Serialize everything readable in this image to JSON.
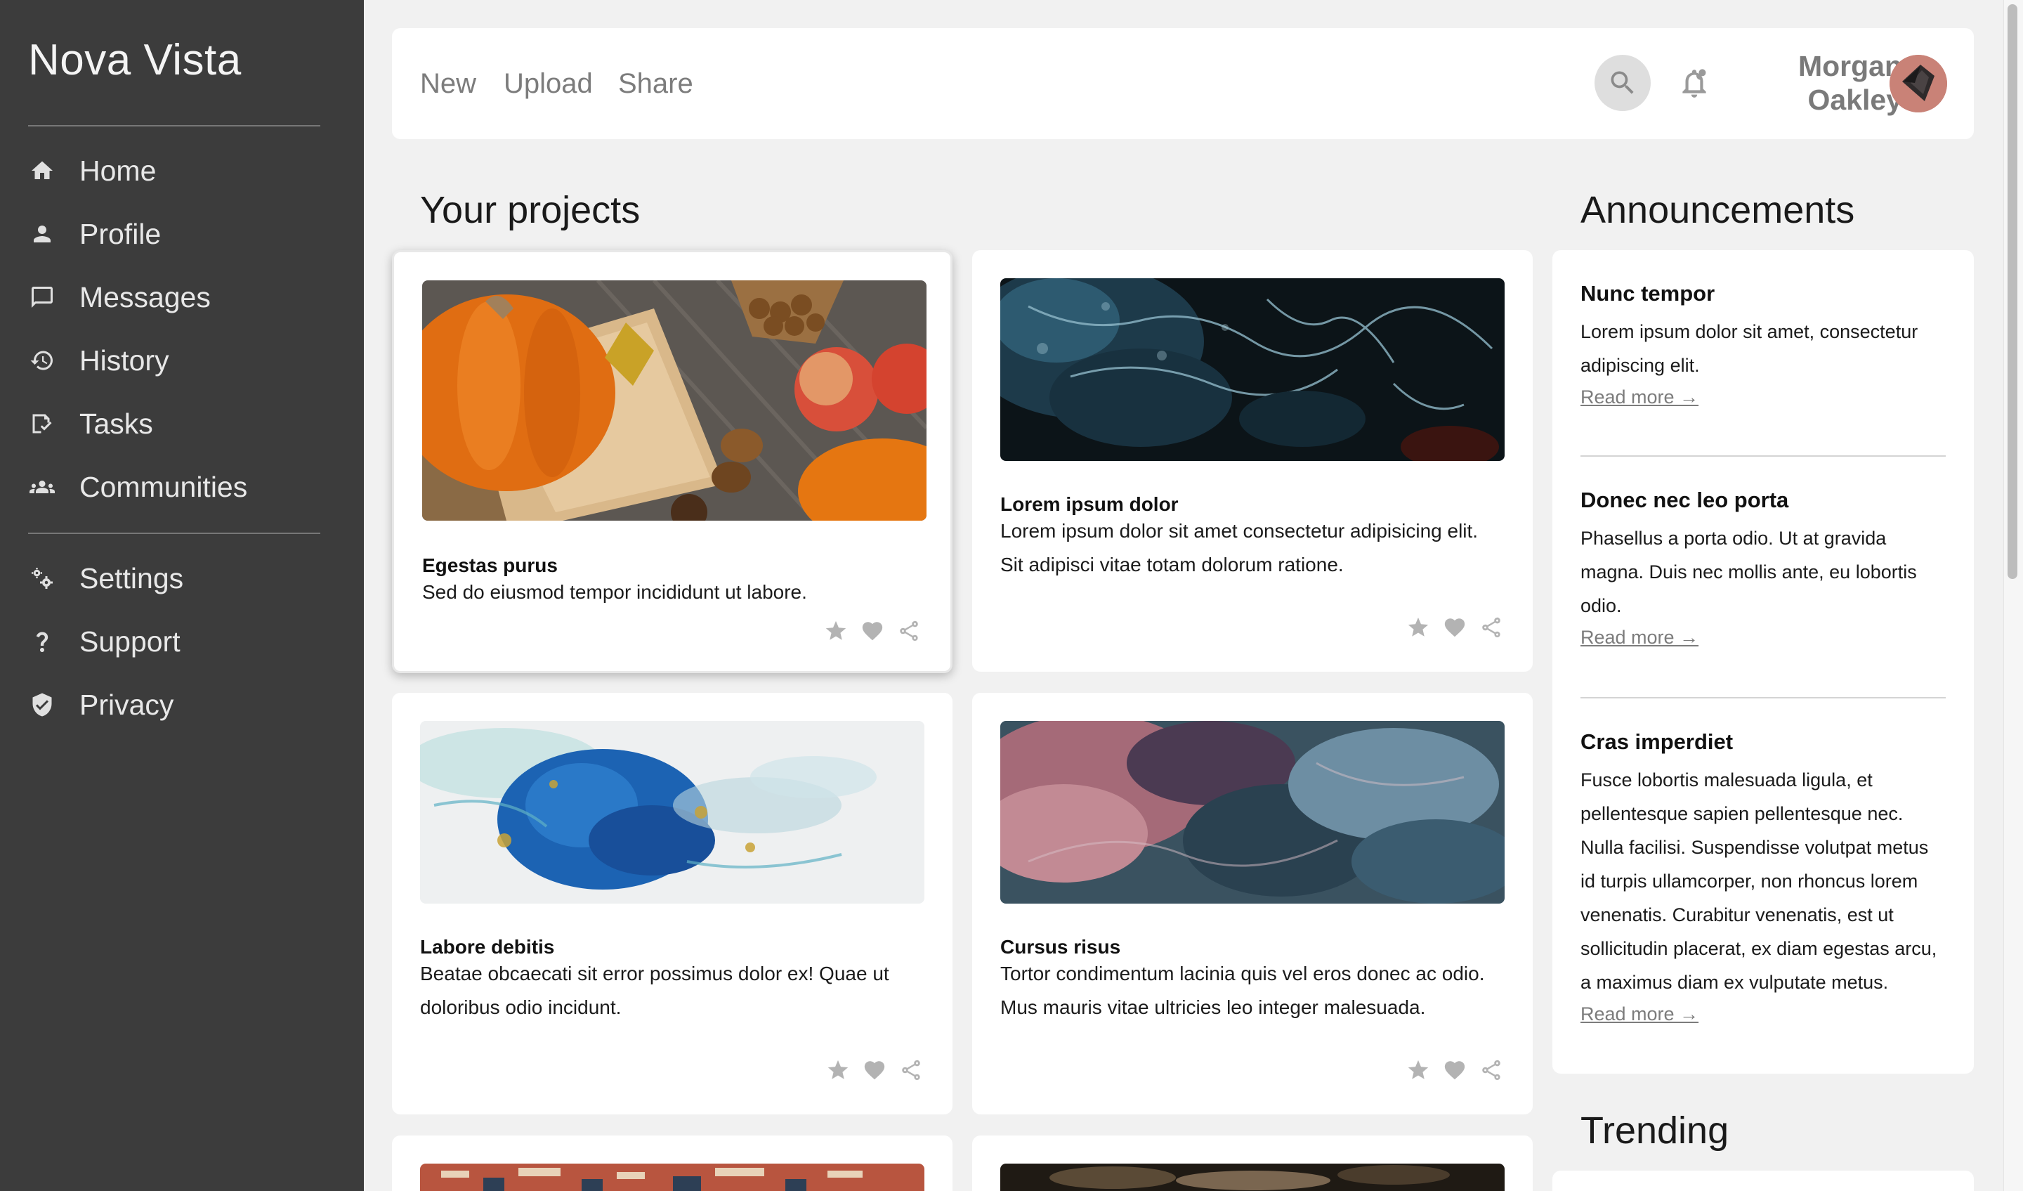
{
  "sidebar": {
    "brand": "Nova Vista",
    "items": [
      {
        "label": "Home",
        "icon": "home-icon"
      },
      {
        "label": "Profile",
        "icon": "person-icon"
      },
      {
        "label": "Messages",
        "icon": "chat-icon"
      },
      {
        "label": "History",
        "icon": "history-icon"
      },
      {
        "label": "Tasks",
        "icon": "tasks-icon"
      },
      {
        "label": "Communities",
        "icon": "group-icon"
      }
    ],
    "secondary_items": [
      {
        "label": "Settings",
        "icon": "gear-icon"
      },
      {
        "label": "Support",
        "icon": "question-icon"
      },
      {
        "label": "Privacy",
        "icon": "shield-icon"
      }
    ]
  },
  "topbar": {
    "tabs": [
      "New",
      "Upload",
      "Share"
    ],
    "search_icon": "search-icon",
    "notification_icon": "bell-icon",
    "user_first": "Morgan",
    "user_last": "Oakley"
  },
  "projects": {
    "heading": "Your projects",
    "cards": [
      {
        "title": "Egestas purus",
        "description": "Sed do eiusmod tempor incididunt ut labore.",
        "image": "autumn-pumpkins-photo"
      },
      {
        "title": "Lorem ipsum dolor",
        "description": "Lorem ipsum dolor sit amet consectetur adipisicing elit. Sit adipisci vitae totam dolorum ratione.",
        "image": "dark-blue-abstract-photo"
      },
      {
        "title": "Labore debitis",
        "description": "Beatae obcaecati sit error possimus dolor ex! Quae ut doloribus odio incidunt.",
        "image": "blue-ink-splash-photo"
      },
      {
        "title": "Cursus risus",
        "description": "Tortor condimentum lacinia quis vel eros donec ac odio. Mus mauris vitae ultricies leo integer malesuada.",
        "image": "pink-teal-smoke-photo"
      }
    ],
    "card_actions": [
      "star-icon",
      "heart-icon",
      "share-icon"
    ]
  },
  "announcements": {
    "heading": "Announcements",
    "items": [
      {
        "title": "Nunc tempor",
        "body": "Lorem ipsum dolor sit amet, consectetur adipiscing elit.",
        "link": "Read more →"
      },
      {
        "title": "Donec nec leo porta",
        "body": "Phasellus a porta odio. Ut at gravida magna. Duis nec mollis ante, eu lobortis odio.",
        "link": "Read more →"
      },
      {
        "title": "Cras imperdiet",
        "body": "Fusce lobortis malesuada ligula, et pellentesque sapien pellentesque nec. Nulla facilisi. Suspendisse volutpat metus id turpis ullamcorper, non rhoncus lorem venenatis. Curabitur venenatis, est ut sollicitudin placerat, ex diam egestas arcu, a maximus diam ex vulputate metus.",
        "link": "Read more →"
      }
    ]
  },
  "trending": {
    "heading": "Trending"
  },
  "colors": {
    "sidebar_bg": "#3c3c3c",
    "page_bg": "#f1f1f1",
    "card_bg": "#ffffff",
    "muted_text": "#7c7c7c"
  }
}
